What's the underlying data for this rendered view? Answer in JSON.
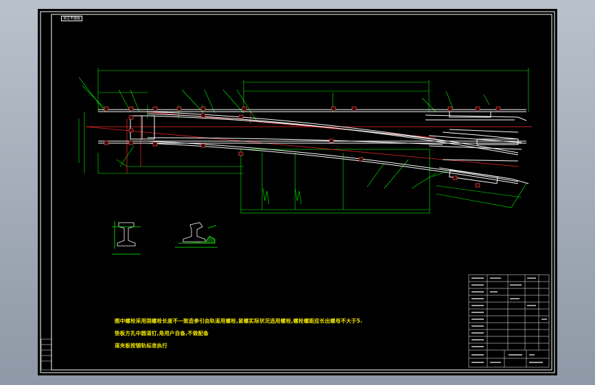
{
  "drawing": {
    "title_tag": "道岔平面图"
  },
  "colors": {
    "background": "#000000",
    "frame": "#ffffff",
    "rail": "#ffffff",
    "dimension": "#00ff00",
    "centerline": "#ff2a2a",
    "note_text": "#f2e600",
    "fastener": "#ff6060"
  },
  "notes": {
    "line1": "图中螺栓采用国螺栓长度不一致造参引由轨道用螺栓,紧螺实际状况选用螺栓,螺栓螺距应长出螺母不大于5.",
    "line2": "垫板方孔中圆道钉,角用户自备,不做配备",
    "line3": "道夹板按钢轨标准执行"
  }
}
